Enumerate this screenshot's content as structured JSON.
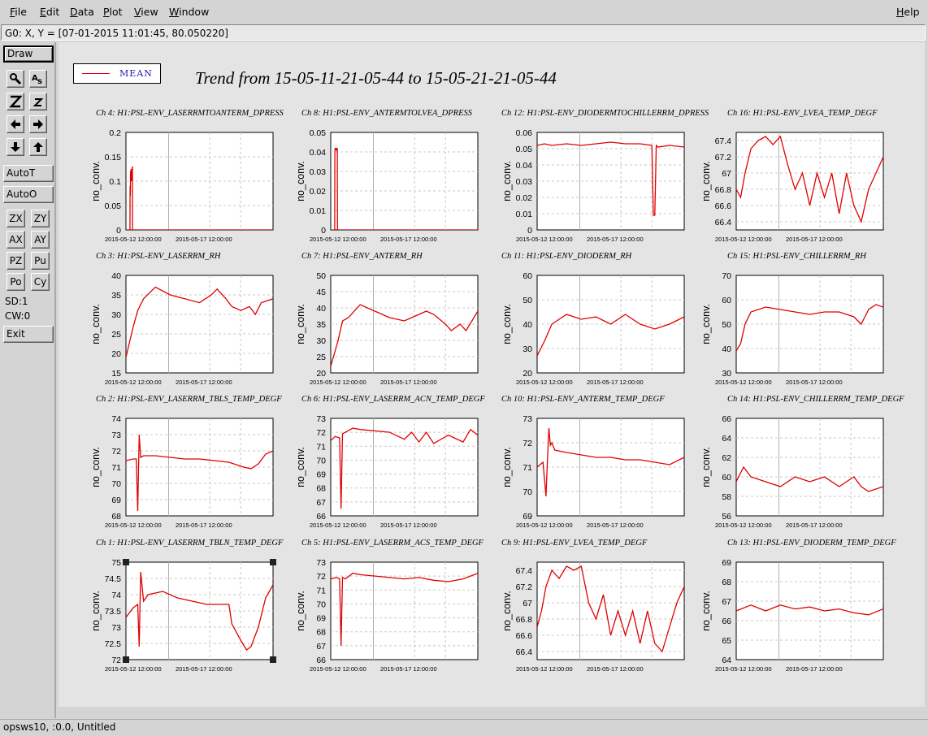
{
  "menu": {
    "items": [
      {
        "label": "File",
        "u": "F",
        "rest": "ile"
      },
      {
        "label": "Edit",
        "u": "E",
        "rest": "dit"
      },
      {
        "label": "Data",
        "u": "D",
        "rest": "ata"
      },
      {
        "label": "Plot",
        "u": "P",
        "rest": "lot"
      },
      {
        "label": "View",
        "u": "V",
        "rest": "iew"
      },
      {
        "label": "Window",
        "u": "W",
        "rest": "indow"
      }
    ],
    "help": {
      "label": "Help",
      "u": "H",
      "rest": "elp"
    }
  },
  "coord_readout": "G0: X, Y = [07-01-2015 11:01:45, 80.050220]",
  "toolbar": {
    "draw": "Draw",
    "autot": "AutoT",
    "autoo": "AutoO",
    "zx": "ZX",
    "zy": "ZY",
    "ax": "AX",
    "ay": "AY",
    "pz": "PZ",
    "pu": "Pu",
    "po": "Po",
    "cy": "Cy",
    "sd": "SD:1",
    "cw": "CW:0",
    "exit": "Exit",
    "icons": [
      "magnify-icon",
      "text-annotate-icon",
      "zoom-in-icon",
      "zoom-out-icon",
      "arrow-left-icon",
      "arrow-right-icon",
      "arrow-down-icon",
      "arrow-up-icon"
    ]
  },
  "legend": {
    "label": "MEAN",
    "color": "#e00000"
  },
  "title": "Trend from 15-05-11-21-05-44 to 15-05-21-21-05-44",
  "status": "opsws10, :0.0, Untitled",
  "chart_data": [
    {
      "type": "line",
      "title": "Ch 4: H1:PSL-ENV_LASERRMTOANTERM_DPRESS",
      "ylabel": "no_conv.",
      "ylim": [
        0,
        0.2
      ],
      "yticks": [
        "0",
        "0.05",
        "0.1",
        "0.15",
        "0.2"
      ],
      "xticks": [
        "2015-05-12 12:00:00",
        "2015-05-17 12:00:00"
      ],
      "series": [
        {
          "name": "MEAN",
          "color": "#e00000",
          "x": [
            0,
            0.02,
            0.027,
            0.028,
            0.03,
            0.031,
            0.033,
            0.035,
            0.037,
            0.04,
            0.044,
            0.045,
            0.3,
            1
          ],
          "y": [
            0,
            0,
            0,
            0.09,
            0.07,
            0.12,
            0.11,
            0.125,
            0.1,
            0.12,
            0.13,
            0,
            0,
            0
          ]
        }
      ]
    },
    {
      "type": "line",
      "title": "Ch 8: H1:PSL-ENV_ANTERMTOLVEA_DPRESS",
      "ylabel": "no_conv.",
      "ylim": [
        0,
        0.05
      ],
      "yticks": [
        "0",
        "0.01",
        "0.02",
        "0.03",
        "0.04",
        "0.05"
      ],
      "xticks": [
        "2015-05-12 12:00:00",
        "2015-05-17 12:00:00"
      ],
      "series": [
        {
          "name": "MEAN",
          "color": "#e00000",
          "x": [
            0,
            0.027,
            0.028,
            0.03,
            0.033,
            0.036,
            0.04,
            0.045,
            0.046,
            0.3,
            1
          ],
          "y": [
            0,
            0,
            0.04,
            0.042,
            0.041,
            0.042,
            0.041,
            0.042,
            0,
            0,
            0
          ]
        }
      ]
    },
    {
      "type": "line",
      "title": "Ch 12: H1:PSL-ENV_DIODERMTOCHILLERRM_DPRESS",
      "ylabel": "no_conv.",
      "ylim": [
        0,
        0.06
      ],
      "yticks": [
        "0",
        "0.01",
        "0.02",
        "0.03",
        "0.04",
        "0.05",
        "0.06"
      ],
      "xticks": [
        "2015-05-12 12:00:00",
        "2015-05-17 12:00:00"
      ],
      "series": [
        {
          "name": "MEAN",
          "color": "#e00000",
          "x": [
            0,
            0.05,
            0.1,
            0.2,
            0.3,
            0.4,
            0.5,
            0.6,
            0.7,
            0.78,
            0.79,
            0.8,
            0.81,
            0.82,
            0.9,
            1
          ],
          "y": [
            0.052,
            0.053,
            0.052,
            0.053,
            0.052,
            0.053,
            0.054,
            0.053,
            0.053,
            0.052,
            0.009,
            0.009,
            0.052,
            0.051,
            0.052,
            0.051
          ]
        }
      ]
    },
    {
      "type": "line",
      "title": "Ch 16: H1:PSL-ENV_LVEA_TEMP_DEGF",
      "ylabel": "no_conv.",
      "ylim": [
        66.3,
        67.5
      ],
      "yticks": [
        "66.4",
        "66.6",
        "66.8",
        "67",
        "67.2",
        "67.4"
      ],
      "xticks": [
        "2015-05-12 12:00:00",
        "2015-05-17 12:00:00"
      ],
      "series": [
        {
          "name": "MEAN",
          "color": "#e00000",
          "x": [
            0,
            0.03,
            0.06,
            0.1,
            0.15,
            0.2,
            0.25,
            0.3,
            0.35,
            0.4,
            0.45,
            0.5,
            0.55,
            0.6,
            0.65,
            0.7,
            0.75,
            0.8,
            0.85,
            0.9,
            0.95,
            1
          ],
          "y": [
            66.8,
            66.7,
            67.0,
            67.3,
            67.4,
            67.45,
            67.35,
            67.45,
            67.1,
            66.8,
            67.0,
            66.6,
            67.0,
            66.7,
            67.0,
            66.5,
            67.0,
            66.6,
            66.4,
            66.8,
            67.0,
            67.2
          ]
        }
      ]
    },
    {
      "type": "line",
      "title": "Ch 3: H1:PSL-ENV_LASERRM_RH",
      "ylabel": "no_conv.",
      "ylim": [
        15,
        40
      ],
      "yticks": [
        "15",
        "20",
        "25",
        "30",
        "35",
        "40"
      ],
      "xticks": [
        "2015-05-12 12:00:00",
        "2015-05-17 12:00:00"
      ],
      "series": [
        {
          "name": "MEAN",
          "color": "#e00000",
          "x": [
            0,
            0.05,
            0.08,
            0.12,
            0.2,
            0.3,
            0.4,
            0.5,
            0.58,
            0.62,
            0.68,
            0.72,
            0.78,
            0.84,
            0.88,
            0.92,
            1
          ],
          "y": [
            19,
            27,
            31,
            34,
            37,
            35,
            34,
            33,
            35,
            36.5,
            34,
            32,
            31,
            32,
            30,
            33,
            34
          ]
        }
      ]
    },
    {
      "type": "line",
      "title": "Ch 7: H1:PSL-ENV_ANTERM_RH",
      "ylabel": "no_conv.",
      "ylim": [
        20,
        50
      ],
      "yticks": [
        "20",
        "25",
        "30",
        "35",
        "40",
        "45",
        "50"
      ],
      "xticks": [
        "2015-05-12 12:00:00",
        "2015-05-17 12:00:00"
      ],
      "series": [
        {
          "name": "MEAN",
          "color": "#e00000",
          "x": [
            0,
            0.05,
            0.08,
            0.12,
            0.2,
            0.3,
            0.4,
            0.5,
            0.55,
            0.65,
            0.7,
            0.78,
            0.82,
            0.88,
            0.92,
            1
          ],
          "y": [
            22,
            30,
            36,
            37,
            41,
            39,
            37,
            36,
            37,
            39,
            38,
            35,
            33,
            35,
            33,
            39
          ]
        }
      ]
    },
    {
      "type": "line",
      "title": "Ch 11: H1:PSL-ENV_DIODERM_RH",
      "ylabel": "no_conv.",
      "ylim": [
        20,
        60
      ],
      "yticks": [
        "20",
        "30",
        "40",
        "50",
        "60"
      ],
      "xticks": [
        "2015-05-12 12:00:00",
        "2015-05-17 12:00:00"
      ],
      "series": [
        {
          "name": "MEAN",
          "color": "#e00000",
          "x": [
            0,
            0.05,
            0.1,
            0.2,
            0.3,
            0.4,
            0.5,
            0.6,
            0.7,
            0.8,
            0.9,
            1
          ],
          "y": [
            27,
            33,
            40,
            44,
            42,
            43,
            40,
            44,
            40,
            38,
            40,
            43
          ]
        }
      ]
    },
    {
      "type": "line",
      "title": "Ch 15: H1:PSL-ENV_CHILLERRM_RH",
      "ylabel": "no_conv.",
      "ylim": [
        30,
        70
      ],
      "yticks": [
        "30",
        "40",
        "50",
        "60",
        "70"
      ],
      "xticks": [
        "2015-05-12 12:00:00",
        "2015-05-17 12:00:00"
      ],
      "series": [
        {
          "name": "MEAN",
          "color": "#e00000",
          "x": [
            0,
            0.03,
            0.06,
            0.1,
            0.2,
            0.3,
            0.4,
            0.5,
            0.6,
            0.7,
            0.8,
            0.85,
            0.9,
            0.95,
            1
          ],
          "y": [
            39,
            42,
            50,
            55,
            57,
            56,
            55,
            54,
            55,
            55,
            53,
            50,
            56,
            58,
            57
          ]
        }
      ]
    },
    {
      "type": "line",
      "title": "Ch 2: H1:PSL-ENV_LASERRM_TBLS_TEMP_DEGF",
      "ylabel": "no_conv.",
      "ylim": [
        68,
        74
      ],
      "yticks": [
        "68",
        "69",
        "70",
        "71",
        "72",
        "73",
        "74"
      ],
      "xticks": [
        "2015-05-12 12:00:00",
        "2015-05-17 12:00:00"
      ],
      "series": [
        {
          "name": "MEAN",
          "color": "#e00000",
          "x": [
            0,
            0.05,
            0.07,
            0.08,
            0.09,
            0.1,
            0.12,
            0.2,
            0.3,
            0.4,
            0.5,
            0.6,
            0.7,
            0.8,
            0.85,
            0.9,
            0.95,
            1
          ],
          "y": [
            71.4,
            71.5,
            71.5,
            68.3,
            73.0,
            71.6,
            71.7,
            71.7,
            71.6,
            71.5,
            71.5,
            71.4,
            71.3,
            71.0,
            70.9,
            71.2,
            71.8,
            72.0
          ]
        }
      ]
    },
    {
      "type": "line",
      "title": "Ch 6: H1:PSL-ENV_LASERRM_ACN_TEMP_DEGF",
      "ylabel": "no_conv.",
      "ylim": [
        66,
        73
      ],
      "yticks": [
        "66",
        "67",
        "68",
        "69",
        "70",
        "71",
        "72",
        "73"
      ],
      "xticks": [
        "2015-05-12 12:00:00",
        "2015-05-17 12:00:00"
      ],
      "series": [
        {
          "name": "MEAN",
          "color": "#e00000",
          "x": [
            0,
            0.03,
            0.06,
            0.07,
            0.08,
            0.1,
            0.15,
            0.2,
            0.3,
            0.4,
            0.5,
            0.55,
            0.6,
            0.65,
            0.7,
            0.8,
            0.9,
            0.95,
            1
          ],
          "y": [
            71.4,
            71.7,
            71.6,
            66.5,
            71.9,
            72.0,
            72.3,
            72.2,
            72.1,
            72.0,
            71.5,
            72.0,
            71.3,
            72.0,
            71.2,
            71.8,
            71.3,
            72.2,
            71.8
          ]
        }
      ]
    },
    {
      "type": "line",
      "title": "Ch 10: H1:PSL-ENV_ANTERM_TEMP_DEGF",
      "ylabel": "no_conv.",
      "ylim": [
        69,
        73
      ],
      "yticks": [
        "69",
        "70",
        "71",
        "72",
        "73"
      ],
      "xticks": [
        "2015-05-12 12:00:00",
        "2015-05-17 12:00:00"
      ],
      "series": [
        {
          "name": "MEAN",
          "color": "#e00000",
          "x": [
            0,
            0.04,
            0.06,
            0.07,
            0.08,
            0.09,
            0.1,
            0.12,
            0.2,
            0.3,
            0.4,
            0.5,
            0.6,
            0.7,
            0.8,
            0.9,
            1
          ],
          "y": [
            71.0,
            71.2,
            69.8,
            71.3,
            72.6,
            71.9,
            72.0,
            71.7,
            71.6,
            71.5,
            71.4,
            71.4,
            71.3,
            71.3,
            71.2,
            71.1,
            71.4
          ]
        }
      ]
    },
    {
      "type": "line",
      "title": "Ch 14: H1:PSL-ENV_CHILLERRM_TEMP_DEGF",
      "ylabel": "no_conv.",
      "ylim": [
        56,
        66
      ],
      "yticks": [
        "56",
        "58",
        "60",
        "62",
        "64",
        "66"
      ],
      "xticks": [
        "2015-05-12 12:00:00",
        "2015-05-17 12:00:00"
      ],
      "series": [
        {
          "name": "MEAN",
          "color": "#e00000",
          "x": [
            0,
            0.05,
            0.1,
            0.2,
            0.3,
            0.4,
            0.5,
            0.6,
            0.7,
            0.8,
            0.85,
            0.9,
            1
          ],
          "y": [
            59.5,
            61,
            60,
            59.5,
            59,
            60,
            59.5,
            60,
            59,
            60,
            59,
            58.5,
            59
          ]
        }
      ]
    },
    {
      "type": "line",
      "title": "Ch 1: H1:PSL-ENV_LASERRM_TBLN_TEMP_DEGF",
      "ylabel": "no_conv.",
      "ylim": [
        72,
        75
      ],
      "yticks": [
        "72",
        "72.5",
        "73",
        "73.5",
        "74",
        "74.5",
        "75"
      ],
      "xticks": [
        "2015-05-12 12:00:00",
        "2015-05-17 12:00:00"
      ],
      "series": [
        {
          "name": "MEAN",
          "color": "#e00000",
          "x": [
            0,
            0.05,
            0.08,
            0.09,
            0.1,
            0.12,
            0.15,
            0.25,
            0.35,
            0.45,
            0.55,
            0.65,
            0.7,
            0.72,
            0.78,
            0.82,
            0.85,
            0.9,
            0.95,
            1
          ],
          "y": [
            73.3,
            73.6,
            73.7,
            72.4,
            74.7,
            73.8,
            74.0,
            74.1,
            73.9,
            73.8,
            73.7,
            73.7,
            73.7,
            73.1,
            72.6,
            72.3,
            72.4,
            73.0,
            73.9,
            74.3
          ]
        }
      ]
    },
    {
      "type": "line",
      "title": "Ch 5: H1:PSL-ENV_LASERRM_ACS_TEMP_DEGF",
      "ylabel": "no_conv.",
      "ylim": [
        66,
        73
      ],
      "yticks": [
        "66",
        "67",
        "68",
        "69",
        "70",
        "71",
        "72",
        "73"
      ],
      "xticks": [
        "2015-05-12 12:00:00",
        "2015-05-17 12:00:00"
      ],
      "series": [
        {
          "name": "MEAN",
          "color": "#e00000",
          "x": [
            0,
            0.04,
            0.06,
            0.07,
            0.08,
            0.1,
            0.15,
            0.2,
            0.3,
            0.4,
            0.5,
            0.6,
            0.7,
            0.8,
            0.9,
            1
          ],
          "y": [
            71.8,
            71.9,
            71.8,
            67.0,
            71.9,
            71.8,
            72.2,
            72.1,
            72.0,
            71.9,
            71.8,
            71.9,
            71.7,
            71.6,
            71.8,
            72.2
          ]
        }
      ]
    },
    {
      "type": "line",
      "title": "Ch 9: H1:PSL-ENV_LVEA_TEMP_DEGF",
      "ylabel": "no_conv.",
      "ylim": [
        66.3,
        67.5
      ],
      "yticks": [
        "66.4",
        "66.6",
        "66.8",
        "67",
        "67.2",
        "67.4"
      ],
      "xticks": [
        "2015-05-12 12:00:00",
        "2015-05-17 12:00:00"
      ],
      "series": [
        {
          "name": "MEAN",
          "color": "#e00000",
          "x": [
            0,
            0.03,
            0.06,
            0.1,
            0.15,
            0.2,
            0.25,
            0.3,
            0.35,
            0.4,
            0.45,
            0.5,
            0.55,
            0.6,
            0.65,
            0.7,
            0.75,
            0.8,
            0.85,
            0.9,
            0.95,
            1
          ],
          "y": [
            66.7,
            66.9,
            67.2,
            67.4,
            67.3,
            67.45,
            67.4,
            67.45,
            67.0,
            66.8,
            67.1,
            66.6,
            66.9,
            66.6,
            66.9,
            66.5,
            66.9,
            66.5,
            66.4,
            66.7,
            67.0,
            67.2
          ]
        }
      ]
    },
    {
      "type": "line",
      "title": "Ch 13: H1:PSL-ENV_DIODERM_TEMP_DEGF",
      "ylabel": "no_conv.",
      "ylim": [
        64,
        69
      ],
      "yticks": [
        "64",
        "65",
        "66",
        "67",
        "68",
        "69"
      ],
      "xticks": [
        "2015-05-12 12:00:00",
        "2015-05-17 12:00:00"
      ],
      "series": [
        {
          "name": "MEAN",
          "color": "#e00000",
          "x": [
            0,
            0.1,
            0.2,
            0.3,
            0.4,
            0.5,
            0.6,
            0.7,
            0.8,
            0.9,
            1
          ],
          "y": [
            66.5,
            66.8,
            66.5,
            66.8,
            66.6,
            66.7,
            66.5,
            66.6,
            66.4,
            66.3,
            66.6
          ]
        }
      ]
    }
  ]
}
